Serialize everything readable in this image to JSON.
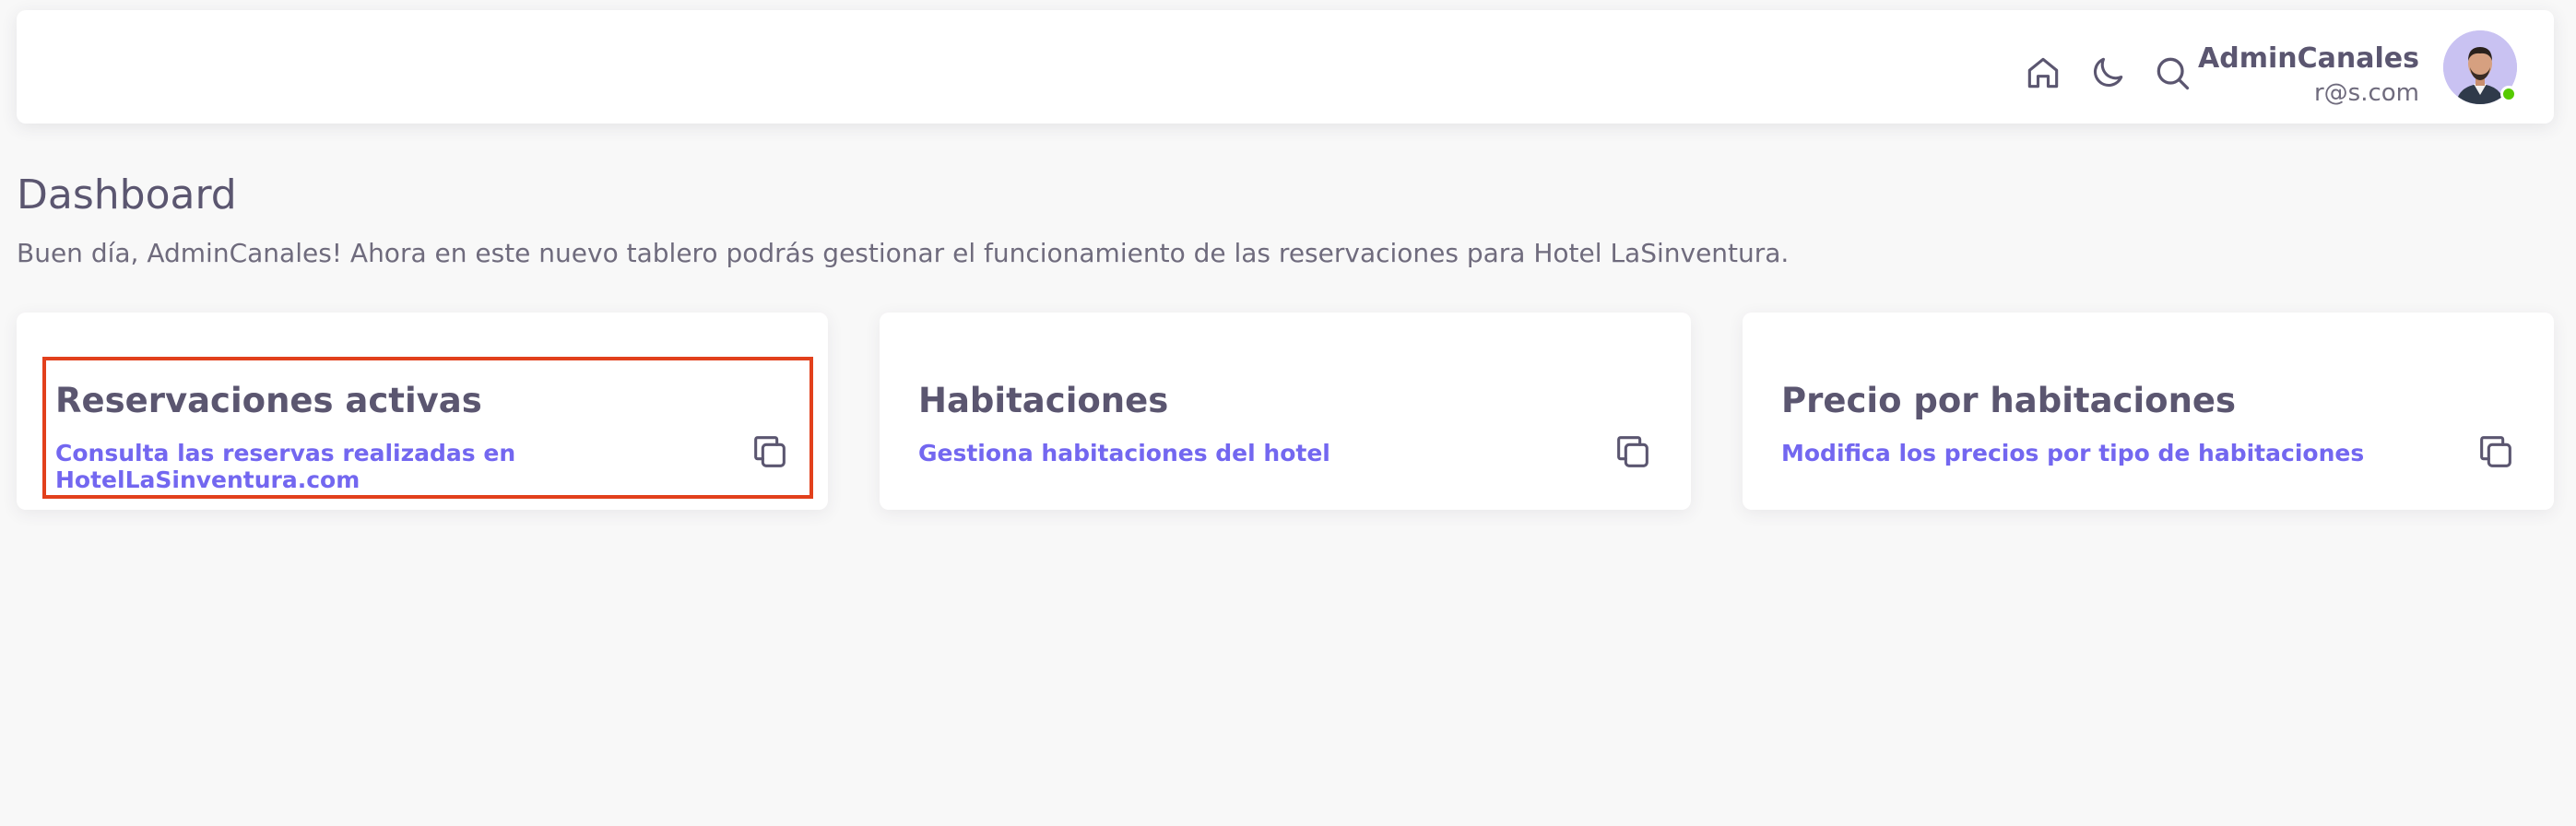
{
  "header": {
    "icons": {
      "home": "home-icon",
      "theme": "moon-icon",
      "search": "search-icon"
    },
    "user": {
      "name": "AdminCanales",
      "email": "r@s.com",
      "status_color": "#56ca00"
    }
  },
  "main": {
    "title": "Dashboard",
    "subtitle": "Buen día, AdminCanales! Ahora en este nuevo tablero podrás gestionar el funcionamiento de las reservaciones para Hotel LaSinventura."
  },
  "cards": [
    {
      "title": "Reservaciones activas",
      "link": "Consulta las reservas realizadas en HotelLaSinventura.com",
      "icon": "copy-icon",
      "highlighted": true
    },
    {
      "title": "Habitaciones",
      "link": "Gestiona habitaciones del hotel",
      "icon": "copy-icon"
    },
    {
      "title": "Precio por habitaciones",
      "link": "Modifica los precios por tipo de habitaciones",
      "icon": "copy-icon"
    }
  ],
  "colors": {
    "accent": "#7367f0",
    "highlight_border": "#e2401c",
    "text": "#5b5670"
  }
}
